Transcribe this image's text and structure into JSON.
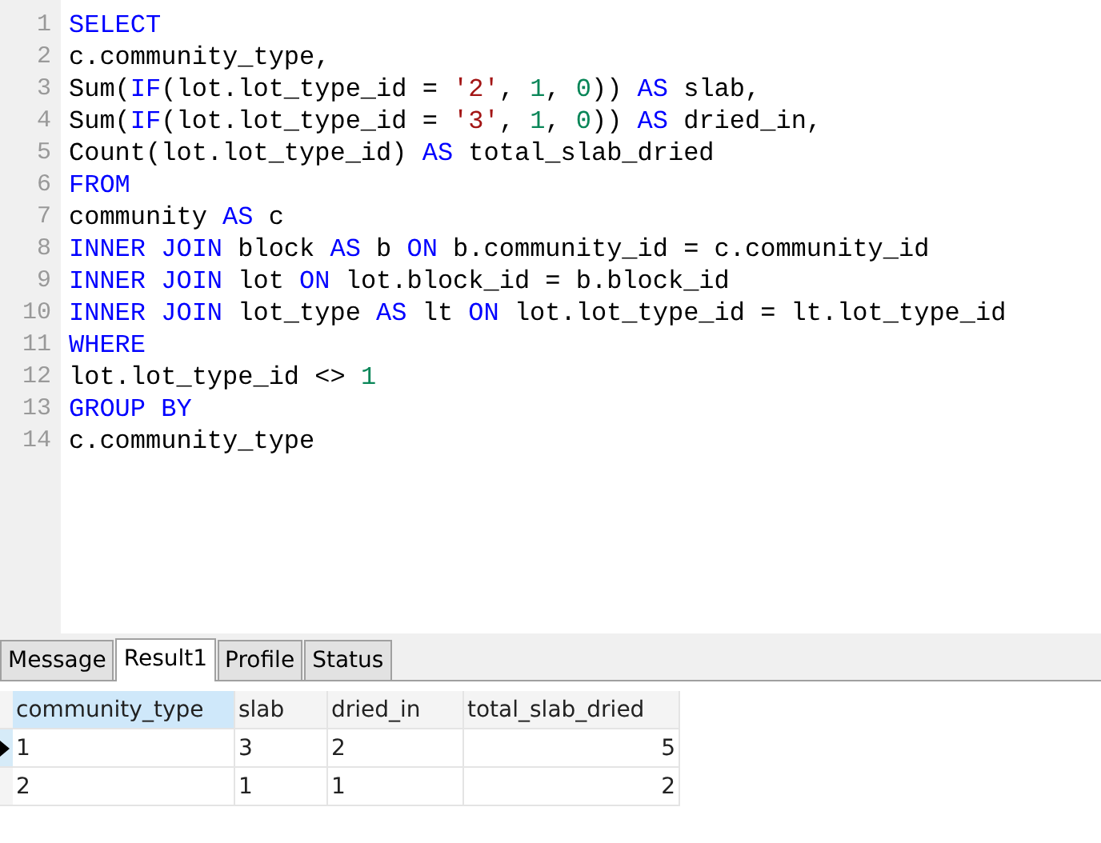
{
  "editor": {
    "lines": [
      {
        "number": "1",
        "tokens": [
          {
            "kind": "keyword",
            "text": "SELECT"
          }
        ]
      },
      {
        "number": "2",
        "tokens": [
          {
            "kind": "plain",
            "text": "c.community_type,"
          }
        ]
      },
      {
        "number": "3",
        "tokens": [
          {
            "kind": "plain",
            "text": "Sum("
          },
          {
            "kind": "keyword",
            "text": "IF"
          },
          {
            "kind": "plain",
            "text": "(lot.lot_type_id = "
          },
          {
            "kind": "string",
            "text": "'2'"
          },
          {
            "kind": "plain",
            "text": ", "
          },
          {
            "kind": "number",
            "text": "1"
          },
          {
            "kind": "plain",
            "text": ", "
          },
          {
            "kind": "number",
            "text": "0"
          },
          {
            "kind": "plain",
            "text": ")) "
          },
          {
            "kind": "keyword",
            "text": "AS"
          },
          {
            "kind": "plain",
            "text": " slab,"
          }
        ]
      },
      {
        "number": "4",
        "tokens": [
          {
            "kind": "plain",
            "text": "Sum("
          },
          {
            "kind": "keyword",
            "text": "IF"
          },
          {
            "kind": "plain",
            "text": "(lot.lot_type_id = "
          },
          {
            "kind": "string",
            "text": "'3'"
          },
          {
            "kind": "plain",
            "text": ", "
          },
          {
            "kind": "number",
            "text": "1"
          },
          {
            "kind": "plain",
            "text": ", "
          },
          {
            "kind": "number",
            "text": "0"
          },
          {
            "kind": "plain",
            "text": ")) "
          },
          {
            "kind": "keyword",
            "text": "AS"
          },
          {
            "kind": "plain",
            "text": " dried_in,"
          }
        ]
      },
      {
        "number": "5",
        "tokens": [
          {
            "kind": "plain",
            "text": "Count(lot.lot_type_id) "
          },
          {
            "kind": "keyword",
            "text": "AS"
          },
          {
            "kind": "plain",
            "text": " total_slab_dried"
          }
        ]
      },
      {
        "number": "6",
        "tokens": [
          {
            "kind": "keyword",
            "text": "FROM"
          }
        ]
      },
      {
        "number": "7",
        "tokens": [
          {
            "kind": "plain",
            "text": "community "
          },
          {
            "kind": "keyword",
            "text": "AS"
          },
          {
            "kind": "plain",
            "text": " c"
          }
        ]
      },
      {
        "number": "8",
        "tokens": [
          {
            "kind": "keyword",
            "text": "INNER JOIN"
          },
          {
            "kind": "plain",
            "text": " block "
          },
          {
            "kind": "keyword",
            "text": "AS"
          },
          {
            "kind": "plain",
            "text": " b "
          },
          {
            "kind": "keyword",
            "text": "ON"
          },
          {
            "kind": "plain",
            "text": " b.community_id = c.community_id"
          }
        ]
      },
      {
        "number": "9",
        "tokens": [
          {
            "kind": "keyword",
            "text": "INNER JOIN"
          },
          {
            "kind": "plain",
            "text": " lot "
          },
          {
            "kind": "keyword",
            "text": "ON"
          },
          {
            "kind": "plain",
            "text": " lot.block_id = b.block_id"
          }
        ]
      },
      {
        "number": "10",
        "tokens": [
          {
            "kind": "keyword",
            "text": "INNER JOIN"
          },
          {
            "kind": "plain",
            "text": " lot_type "
          },
          {
            "kind": "keyword",
            "text": "AS"
          },
          {
            "kind": "plain",
            "text": " lt "
          },
          {
            "kind": "keyword",
            "text": "ON"
          },
          {
            "kind": "plain",
            "text": " lot.lot_type_id = lt.lot_type_id"
          }
        ]
      },
      {
        "number": "11",
        "tokens": [
          {
            "kind": "keyword",
            "text": "WHERE"
          }
        ]
      },
      {
        "number": "12",
        "tokens": [
          {
            "kind": "plain",
            "text": "lot.lot_type_id <> "
          },
          {
            "kind": "number",
            "text": "1"
          }
        ]
      },
      {
        "number": "13",
        "tokens": [
          {
            "kind": "keyword",
            "text": "GROUP BY"
          }
        ]
      },
      {
        "number": "14",
        "tokens": [
          {
            "kind": "plain",
            "text": "c.community_type"
          }
        ]
      }
    ]
  },
  "tabs": [
    {
      "label": "Message",
      "selected": false
    },
    {
      "label": "Result1",
      "selected": true
    },
    {
      "label": "Profile",
      "selected": false
    },
    {
      "label": "Status",
      "selected": false
    }
  ],
  "result": {
    "columns": [
      {
        "label": "community_type",
        "kind": "text",
        "selected": true
      },
      {
        "label": "slab",
        "kind": "text",
        "selected": false
      },
      {
        "label": "dried_in",
        "kind": "text",
        "selected": false
      },
      {
        "label": "total_slab_dried",
        "kind": "numeric",
        "selected": false
      }
    ],
    "rows": [
      {
        "selected": true,
        "cells": [
          "1",
          "3",
          "2",
          "5"
        ]
      },
      {
        "selected": false,
        "cells": [
          "2",
          "1",
          "1",
          "2"
        ]
      }
    ]
  }
}
